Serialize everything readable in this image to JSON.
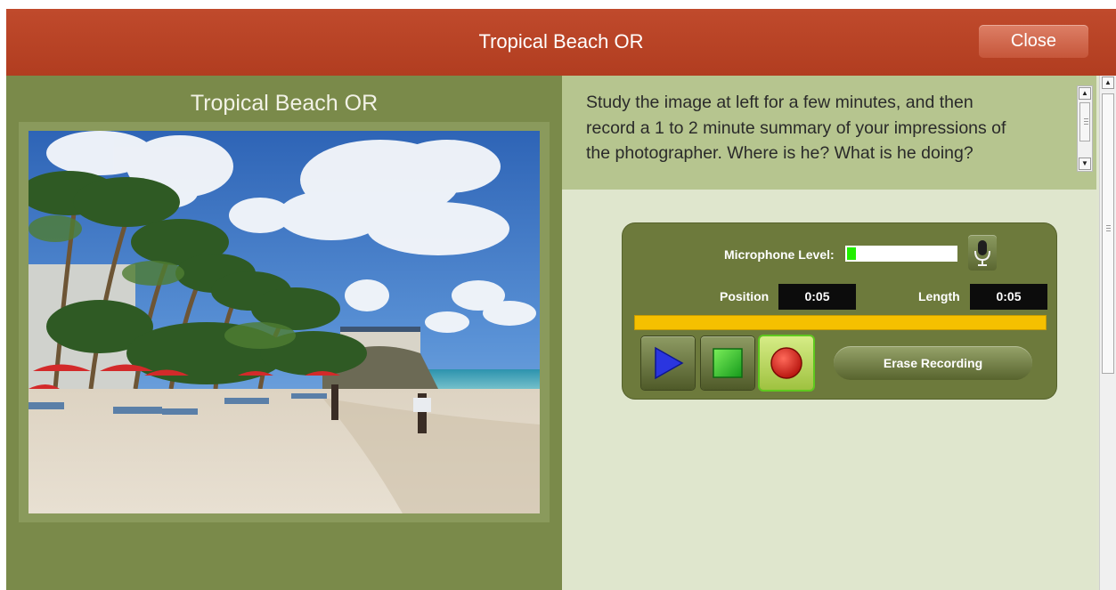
{
  "window": {
    "title": "Tropical Beach OR",
    "close_label": "Close"
  },
  "left_panel": {
    "title": "Tropical Beach OR",
    "image_icon": "beach-photo"
  },
  "instructions": {
    "line1": "Study the image at left for a few minutes, and then",
    "line2": "record a 1 to 2 minute summary of your impressions of",
    "line3": "the photographer.   Where is he?  What is he doing?"
  },
  "recorder": {
    "mic_label": "Microphone Level:",
    "mic_level": 0.08,
    "mic_icon": "microphone-icon",
    "position_label": "Position",
    "position_value": "0:05",
    "length_label": "Length",
    "length_value": "0:05",
    "progress": 1.0,
    "play_icon": "play-icon",
    "stop_icon": "stop-icon",
    "record_icon": "record-icon",
    "record_active": true,
    "erase_label": "Erase Recording"
  },
  "colors": {
    "titlebar": "#b93f22",
    "panel_olive": "#7a8a4a",
    "recorder_bg": "#6d7a3c",
    "progress": "#f5c000",
    "mic_level": "#22ee00"
  }
}
